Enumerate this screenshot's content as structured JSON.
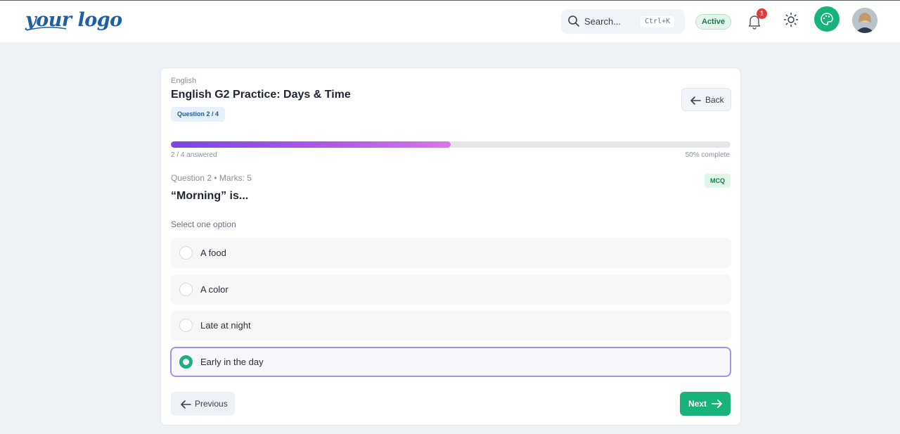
{
  "header": {
    "logo_text": "your logo",
    "search": {
      "label": "Search...",
      "shortcut": "Ctrl+K"
    },
    "status_badge": "Active",
    "notification_count": "1",
    "colors": {
      "accent": "#17b37a",
      "badge": "#e23b3b"
    }
  },
  "quiz": {
    "subject": "English",
    "title": "English G2 Practice: Days & Time",
    "question_chip": "Question 2 / 4",
    "back_label": "Back",
    "progress": {
      "answered_text": "2 / 4 answered",
      "complete_text": "50% complete",
      "fraction": 0.5
    },
    "question": {
      "meta": "Question 2 • Marks: 5",
      "type": "MCQ",
      "text": "“Morning” is...",
      "instruction": "Select one option",
      "options": [
        {
          "label": "A food",
          "selected": false
        },
        {
          "label": "A color",
          "selected": false
        },
        {
          "label": "Late at night",
          "selected": false
        },
        {
          "label": "Early in the day",
          "selected": true
        }
      ]
    },
    "prev_label": "Previous",
    "next_label": "Next"
  }
}
